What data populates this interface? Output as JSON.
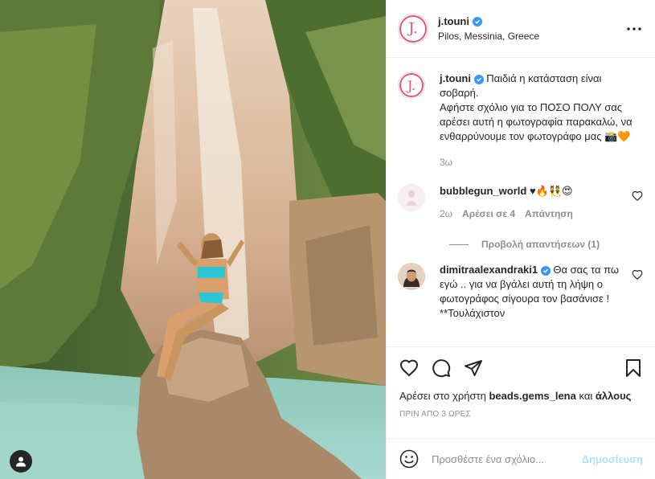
{
  "post": {
    "username": "j.touni",
    "avatar_letter": "J.",
    "location": "Pilos, Messinia, Greece"
  },
  "caption": {
    "username": "j.touni",
    "text": "Παιδιά η κατάσταση είναι σοβαρή.",
    "text2": "Αφήστε σχόλιο για το ΠΟΣΟ ΠΟΛΥ σας αρέσει αυτή η φωτογραφία παρακαλώ, να ενθαρρύνουμε τον φωτογράφο μας 📸🧡",
    "age": "3ω"
  },
  "comments": [
    {
      "username": "bubblegun_world",
      "text": "♥🔥👯😍",
      "age": "2ω",
      "likes_label": "Αρέσει σε 4",
      "reply_label": "Απάντηση",
      "view_replies": "Προβολή απαντήσεων (1)"
    },
    {
      "username": "dimitraalexandraki1",
      "text": "Θα σας τα πω εγώ .. για να βγάλει αυτή τη λήψη ο φωτογράφος σίγουρα τον βασάνισε ! **Τουλάχιστον"
    }
  ],
  "likes": {
    "prefix": "Αρέσει στο χρήστη",
    "user": "beads.gems_lena",
    "and": "και",
    "others": "άλλους"
  },
  "timestamp": "ΠΡΙΝ ΑΠΟ 3 ΩΡΕΣ",
  "add_comment": {
    "placeholder": "Προσθέστε ένα σχόλιο...",
    "post_label": "Δημοσίευση"
  },
  "colors": {
    "verified": "#3897f0",
    "brand_pink": "#e8567a",
    "post_button_disabled": "#b2dffc"
  },
  "icons": {
    "more": "more-horizontal-icon",
    "like": "heart-icon",
    "comment": "comment-icon",
    "share": "paper-plane-icon",
    "save": "bookmark-icon",
    "emoji": "emoji-icon",
    "tags": "user-tag-icon"
  }
}
